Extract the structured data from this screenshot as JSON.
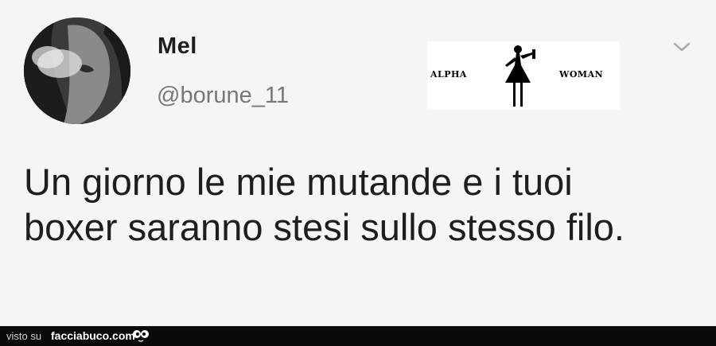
{
  "tweet": {
    "display_name": "Mel",
    "handle": "@borune_11",
    "text": "Un giorno le mie mutande e i tuoi boxer saranno stesi sullo stesso filo."
  },
  "logo": {
    "left_word": "ALPHA",
    "right_word": "WOMAN"
  },
  "footer": {
    "visto": "visto su",
    "site": "facciabuco.com"
  },
  "icons": {
    "chevron": "chevron-down-icon",
    "mascot": "eyes-icon"
  }
}
